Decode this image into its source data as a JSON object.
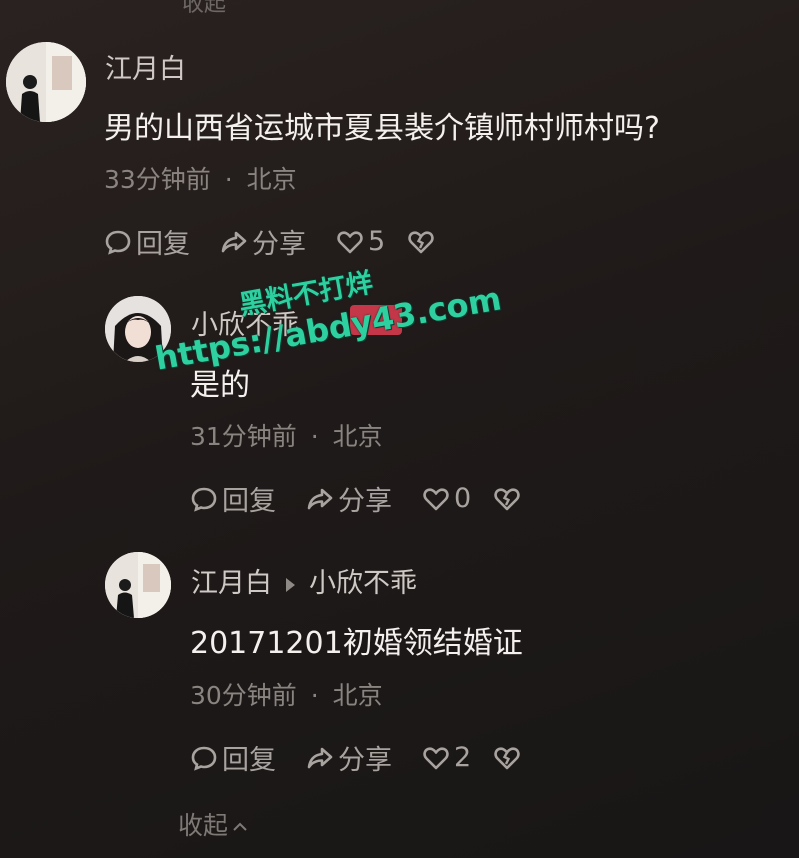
{
  "top_cut_text": "收起",
  "comments": [
    {
      "username": "江月白",
      "text": "男的山西省运城市夏县裴介镇师村师村吗?",
      "time": "33分钟前",
      "location": "北京",
      "reply_label": "回复",
      "share_label": "分享",
      "likes": "5"
    },
    {
      "username": "小欣不乖",
      "text": "是的",
      "time": "31分钟前",
      "location": "北京",
      "reply_label": "回复",
      "share_label": "分享",
      "likes": "0"
    },
    {
      "username": "江月白",
      "reply_to": "小欣不乖",
      "text": "20171201初婚领结婚证",
      "time": "30分钟前",
      "location": "北京",
      "reply_label": "回复",
      "share_label": "分享",
      "likes": "2"
    }
  ],
  "meta_separator": "·",
  "collapse_label": "收起",
  "watermark": {
    "line1": "黑料不打烊",
    "line2": "https://abdy43.com",
    "color": "#2fd0a0"
  },
  "colors": {
    "background": "#1e1a18",
    "text_primary": "#f3f0ee",
    "text_secondary": "#8a8480"
  },
  "icons": [
    "reply-bubble-icon",
    "share-arrow-icon",
    "heart-icon",
    "broken-heart-icon",
    "reply-to-arrow-icon"
  ]
}
